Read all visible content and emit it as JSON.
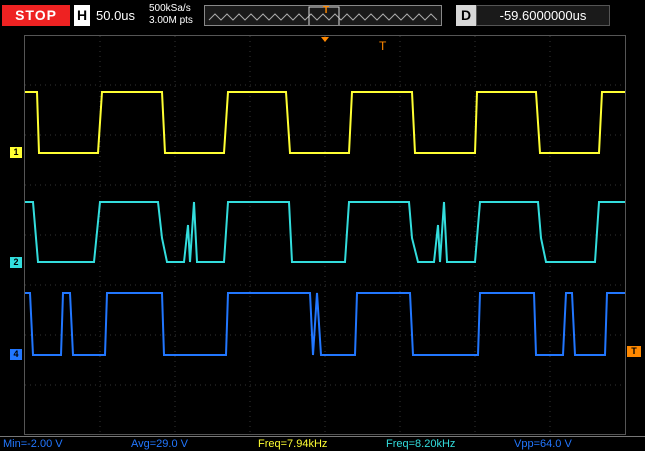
{
  "status": {
    "run_state": "STOP"
  },
  "horizontal": {
    "label": "H",
    "timebase": "50.0us",
    "sample_rate": "500kSa/s",
    "memory_depth": "3.00M pts"
  },
  "trigger": {
    "label": "T"
  },
  "delay": {
    "label": "D",
    "value": "-59.6000000us"
  },
  "channels": [
    {
      "id": "1",
      "color": "#ffff33"
    },
    {
      "id": "2",
      "color": "#33dddd"
    },
    {
      "id": "4",
      "color": "#2277ff"
    }
  ],
  "measurements": [
    {
      "text": "Min=-2.00 V",
      "color": "#2277ff"
    },
    {
      "text": "Avg=29.0 V",
      "color": "#2277ff"
    },
    {
      "text": "Freq=7.94kHz",
      "color": "#ffff33"
    },
    {
      "text": "Freq=8.20kHz",
      "color": "#33dddd"
    },
    {
      "text": "Vpp=64.0 V",
      "color": "#2277ff"
    }
  ]
}
